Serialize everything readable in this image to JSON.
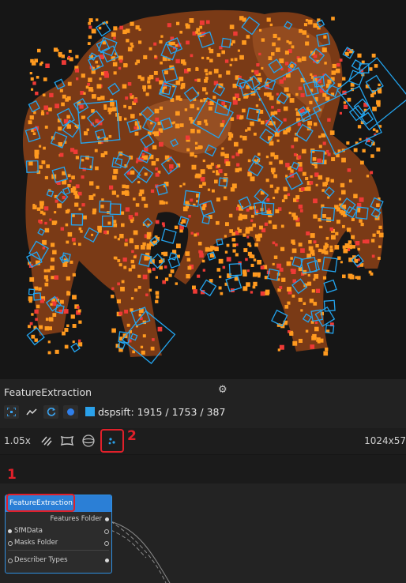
{
  "viewer": {
    "subject": "elephant-image",
    "marker_colors": {
      "orange": "#ff9a1f",
      "red": "#ee3a36",
      "blue": "#23a5f0"
    }
  },
  "info_panel": {
    "title": "FeatureExtraction",
    "describer_label": "dspsift: 1915 / 1753 / 387",
    "describer_color": "#2aa1ea"
  },
  "view_toolbar": {
    "zoom": "1.05x",
    "resolution": "1024x57"
  },
  "graph": {
    "node": {
      "title": "FeatureExtraction",
      "header_color": "#2b7fd6",
      "ports": {
        "features_folder": "Features Folder",
        "sfmdata": "SfMData",
        "masks_folder": "Masks Folder",
        "describer_types": "Describer Types"
      }
    }
  },
  "annotations": {
    "one": "1",
    "two": "2",
    "color": "#e0202a"
  }
}
